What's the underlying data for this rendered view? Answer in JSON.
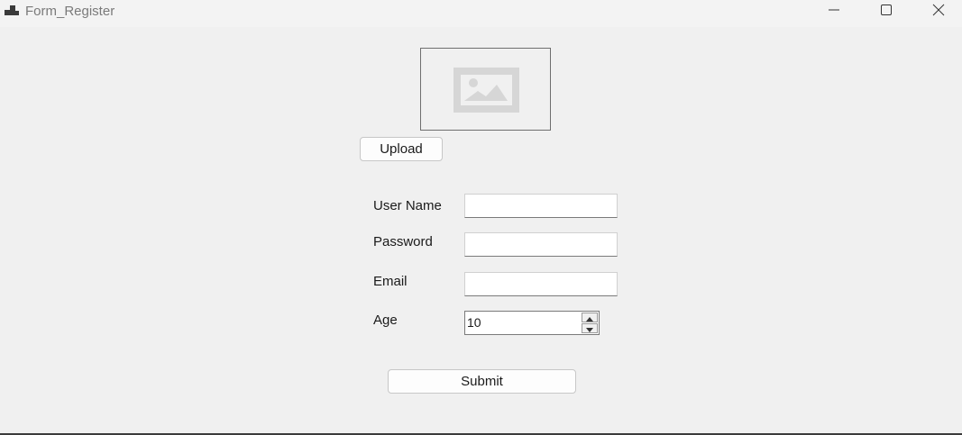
{
  "window": {
    "title": "Form_Register",
    "icons": {
      "app": "app-icon",
      "minimize": "minimize-icon",
      "maximize": "maximize-icon",
      "close": "close-icon"
    }
  },
  "picture": {
    "icon": "image-placeholder-icon"
  },
  "buttons": {
    "upload_label": "Upload",
    "submit_label": "Submit"
  },
  "fields": {
    "username_label": "User Name",
    "username_value": "",
    "password_label": "Password",
    "password_value": "",
    "email_label": "Email",
    "email_value": "",
    "age_label": "Age",
    "age_value": "10"
  }
}
